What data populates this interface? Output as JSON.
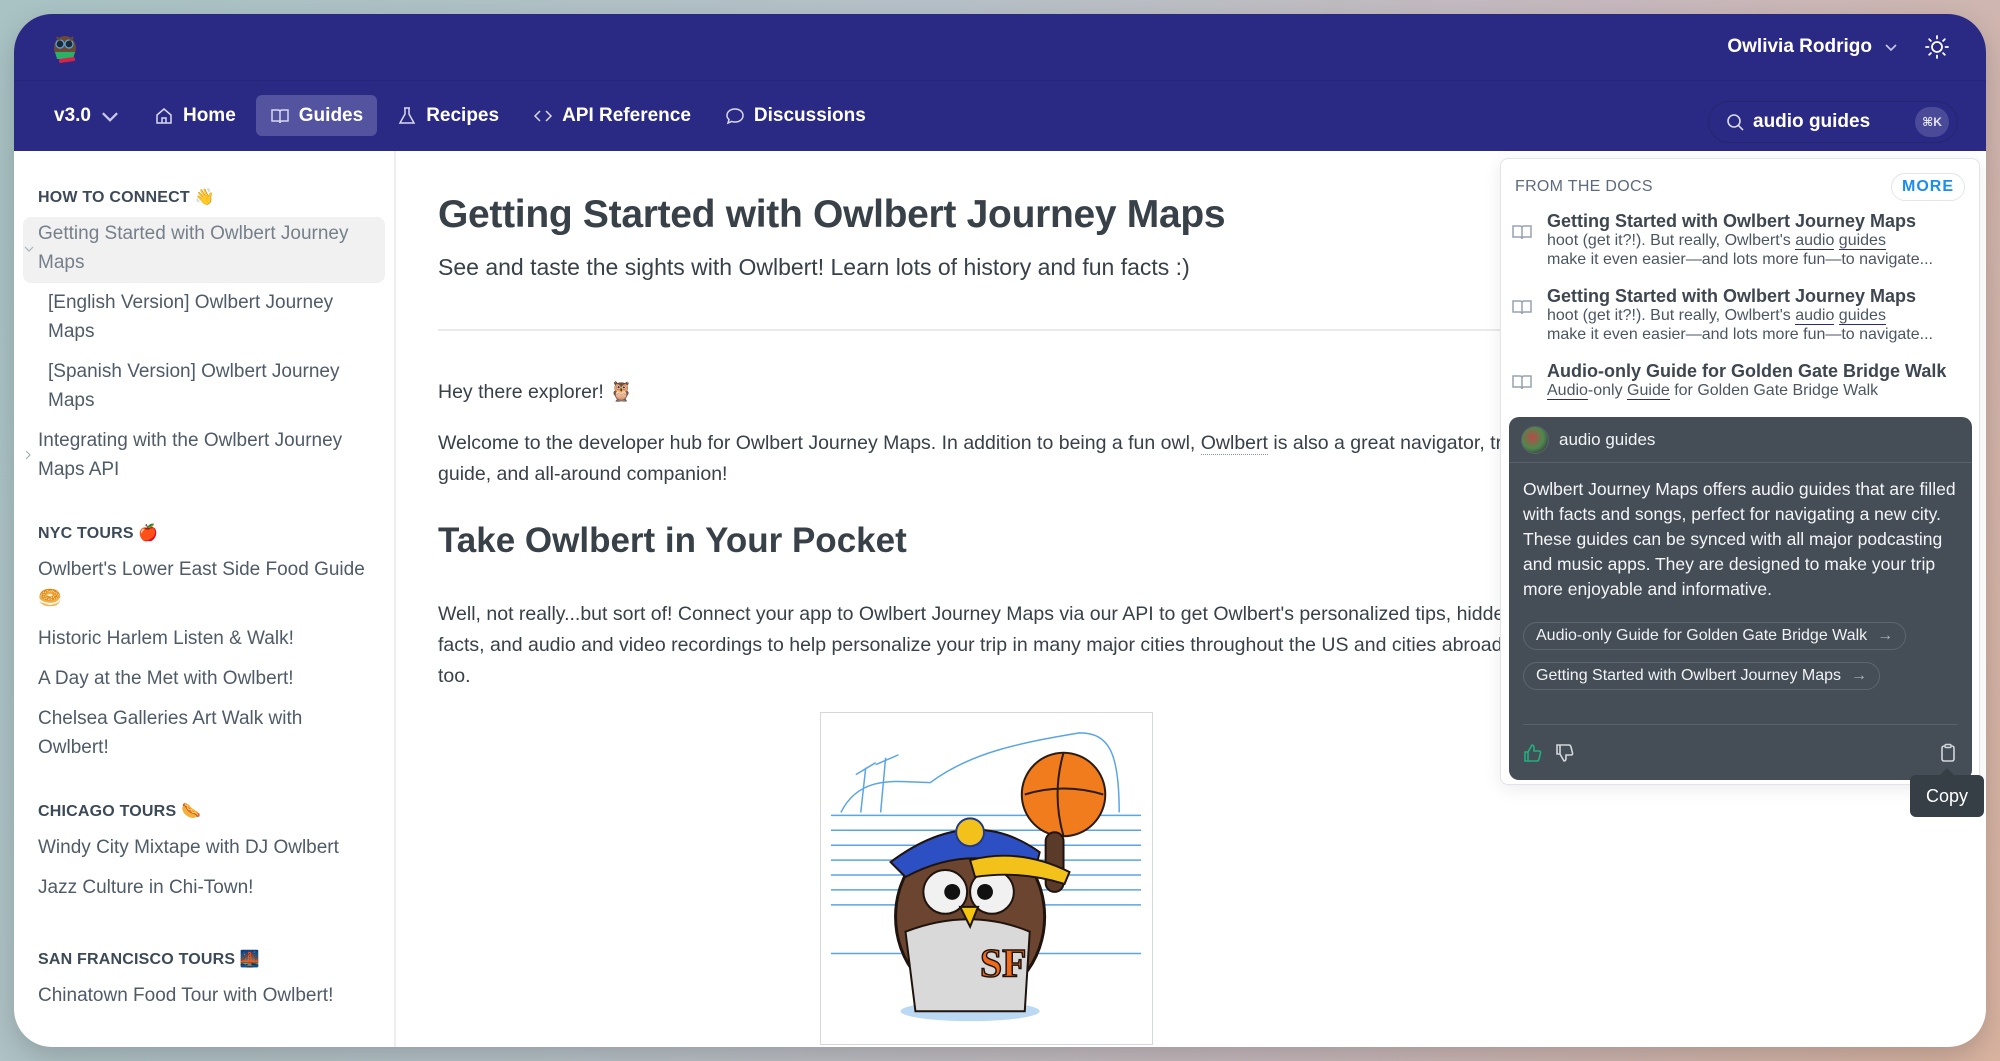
{
  "header": {
    "logo_alt": "Owlbert logo",
    "user_name": "Owlivia Rodrigo",
    "theme_toggle_icon": "sun-icon"
  },
  "nav": {
    "version": "v3.0",
    "items": [
      {
        "label": "Home",
        "icon": "home-icon",
        "active": false
      },
      {
        "label": "Guides",
        "icon": "book-icon",
        "active": true
      },
      {
        "label": "Recipes",
        "icon": "flask-icon",
        "active": false
      },
      {
        "label": "API Reference",
        "icon": "code-icon",
        "active": false
      },
      {
        "label": "Discussions",
        "icon": "chat-bubble-icon",
        "active": false
      }
    ],
    "search": {
      "value": "audio guides",
      "shortcut": "⌘K"
    }
  },
  "sidebar": {
    "sections": [
      {
        "title": "HOW TO CONNECT 👋",
        "items": [
          {
            "label": "Getting Started with Owlbert Journey Maps",
            "active": true,
            "expanded": true
          },
          {
            "label": "[English Version] Owlbert Journey Maps",
            "sub": true
          },
          {
            "label": "[Spanish Version] Owlbert Journey Maps",
            "sub": true
          },
          {
            "label": "Integrating with the Owlbert Journey Maps API",
            "collapsed": true
          }
        ]
      },
      {
        "title": "NYC TOURS 🍎",
        "items": [
          {
            "label": "Owlbert's Lower East Side Food Guide 🥯"
          },
          {
            "label": "Historic Harlem Listen & Walk!"
          },
          {
            "label": "A Day at the Met with Owlbert!"
          },
          {
            "label": "Chelsea Galleries Art Walk with Owlbert!"
          }
        ]
      },
      {
        "title": "CHICAGO TOURS 🌭",
        "items": [
          {
            "label": "Windy City Mixtape with DJ Owlbert"
          },
          {
            "label": "Jazz Culture in Chi-Town!"
          }
        ]
      },
      {
        "title": "SAN FRANCISCO TOURS 🌉",
        "items": [
          {
            "label": "Chinatown Food Tour with Owlbert!"
          }
        ]
      }
    ]
  },
  "main": {
    "title": "Getting Started with Owlbert Journey Maps",
    "subtitle": "See and taste the sights with Owlbert! Learn lots of history and fun facts :)",
    "greeting": "Hey there explorer! 🦉",
    "intro_before_link": "Welcome to the developer hub for Owlbert Journey Maps. In addition to being a fun owl, ",
    "intro_link": "Owlbert",
    "intro_after_link": " is also a great navigator, travel guide, and all-around companion!",
    "section_heading": "Take Owlbert in Your Pocket",
    "section_body": "Well, not really...but sort of! Connect your app to Owlbert Journey Maps via our API to get Owlbert's personalized tips, hidden facts, and audio and video recordings to help personalize your trip in many major cities throughout the US and cities abroad too.",
    "image_alt": "Owlbert in Giants jersey spinning a basketball"
  },
  "search_dropdown": {
    "label": "FROM THE DOCS",
    "more_label": "MORE",
    "results": [
      {
        "title": "Getting Started with Owlbert Journey Maps",
        "snippet_pre": "hoot (get it?!). But really, Owlbert's ",
        "hl1": "audio",
        "mid": " ",
        "hl2": "guides",
        "snippet_post": "make it even easier—and lots more fun—to navigate..."
      },
      {
        "title": "Getting Started with Owlbert Journey Maps",
        "snippet_pre": "hoot (get it?!). But really, Owlbert's ",
        "hl1": "audio",
        "mid": " ",
        "hl2": "guides",
        "snippet_post": "make it even easier—and lots more fun—to navigate..."
      },
      {
        "title": "Audio-only Guide for Golden Gate Bridge Walk",
        "hl1": "Audio",
        "mid": "-only ",
        "hl2": "Guide",
        "snippet_post": " for Golden Gate Bridge Walk"
      }
    ],
    "ai": {
      "query": "audio guides",
      "answer": "Owlbert Journey Maps offers audio guides that are filled with facts and songs, perfect for navigating a new city. These guides can be synced with all major podcasting and music apps. They are designed to make your trip more enjoyable and informative.",
      "sources": [
        "Audio-only Guide for Golden Gate Bridge Walk",
        "Getting Started with Owlbert Journey Maps"
      ],
      "tooltip": "Copy"
    }
  },
  "colors": {
    "brand_navy": "#2a2a85",
    "active_nav": "#5353a0",
    "more_link": "#1a8df0",
    "ai_panel": "#454d56",
    "thumbs_up": "#21b07f",
    "text": "#384048"
  }
}
